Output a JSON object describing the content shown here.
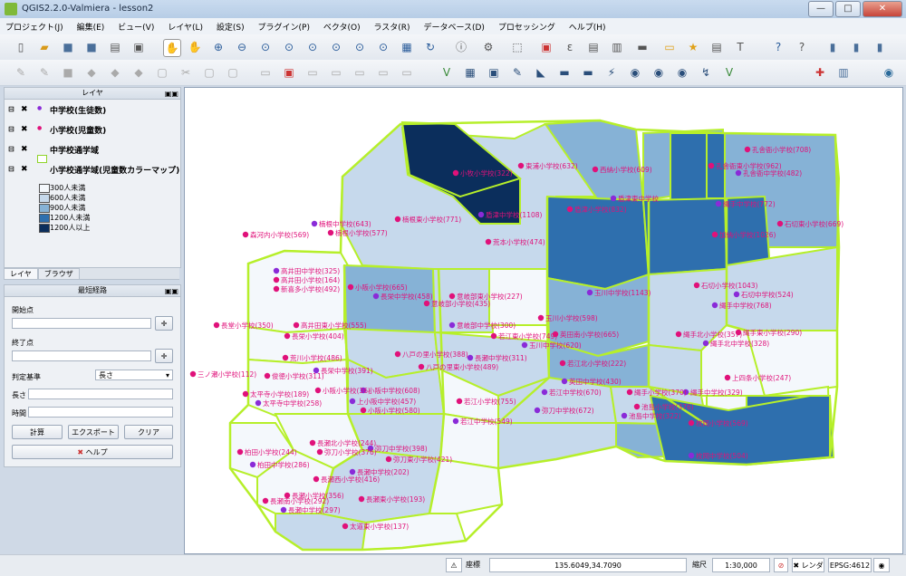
{
  "window": {
    "title": "QGIS2.2.0-Valmiera - lesson2",
    "minimize": "—",
    "maximize": "□",
    "close": "✕"
  },
  "menu": [
    "プロジェクト(J)",
    "編集(E)",
    "ビュー(V)",
    "レイヤ(L)",
    "設定(S)",
    "プラグイン(P)",
    "ベクタ(O)",
    "ラスタ(R)",
    "データベース(D)",
    "プロセッシング",
    "ヘルプ(H)"
  ],
  "layers_panel": {
    "title": "レイヤ",
    "layers": [
      {
        "name": "中学校(生徒数)"
      },
      {
        "name": "小学校(児童数)"
      },
      {
        "name": "中学校通学域"
      },
      {
        "name": "小学校通学域(児童数カラーマップ)"
      }
    ],
    "legend": [
      {
        "label": "300人未満",
        "color": "#f4f8fc"
      },
      {
        "label": "600人未満",
        "color": "#c6d9ec"
      },
      {
        "label": "900人未満",
        "color": "#86b2d6"
      },
      {
        "label": "1200人未満",
        "color": "#2e6fae"
      },
      {
        "label": "1200人以上",
        "color": "#0b2e5c"
      }
    ]
  },
  "tabs": [
    "レイヤ",
    "ブラウザ"
  ],
  "route_panel": {
    "title": "最短経路",
    "start_label": "開始点",
    "end_label": "終了点",
    "criterion_label": "判定基準",
    "criterion_value": "長さ",
    "length_label": "長さ",
    "time_label": "時間",
    "calc": "計算",
    "export": "エクスポート",
    "clear": "クリア",
    "help": "ヘルプ"
  },
  "map_labels": [
    {
      "t": "東浦小学校(632)"
    },
    {
      "t": "西納小学校(609)"
    },
    {
      "t": "小牧小学校(322)"
    },
    {
      "t": "孔舎衙小学校(708)"
    },
    {
      "t": "孔舎衙東小学校(962)"
    },
    {
      "t": "孔舎衙中学校(482)"
    },
    {
      "t": "森河内小学校(569)"
    },
    {
      "t": "楠根中学校(643)"
    },
    {
      "t": "楠根小学校(577)"
    },
    {
      "t": "楠根東小学校(771)"
    },
    {
      "t": "盾津中学校(1108)"
    },
    {
      "t": "盾津東中学校"
    },
    {
      "t": "盾津小学校(832)"
    },
    {
      "t": "縄手中学校(772)"
    },
    {
      "t": "石切東小学校(669)"
    },
    {
      "t": "加納小学校(1026)"
    },
    {
      "t": "荒本小学校(474)"
    },
    {
      "t": "長堂小学校(350)"
    },
    {
      "t": "高井田中学校(325)"
    },
    {
      "t": "高井田小学校(164)"
    },
    {
      "t": "新喜多小学校(492)"
    },
    {
      "t": "小阪小学校(665)"
    },
    {
      "t": "長栄中学校(458)"
    },
    {
      "t": "意岐部東小学校(227)"
    },
    {
      "t": "意岐部小学校(435)"
    },
    {
      "t": "玉川中学校(1143)"
    },
    {
      "t": "石切小学校(1043)"
    },
    {
      "t": "石切中学校(524)"
    },
    {
      "t": "縄手中学校(768)"
    },
    {
      "t": "高井田東小学校(555)"
    },
    {
      "t": "長栄小学校(404)"
    },
    {
      "t": "意岐部中学校(300)"
    },
    {
      "t": "玉川小学校(598)"
    },
    {
      "t": "若江東小学校(749)"
    },
    {
      "t": "英田南小学校(665)"
    },
    {
      "t": "縄手北小学校(357)"
    },
    {
      "t": "縄手東小学校(290)"
    },
    {
      "t": "縄手北中学校(328)"
    },
    {
      "t": "八戸の里小学校(388)"
    },
    {
      "t": "玉川中学校(620)"
    },
    {
      "t": "荒川小学校(486)"
    },
    {
      "t": "長瀬中学校(311)"
    },
    {
      "t": "三ノ瀬小学校(112)"
    },
    {
      "t": "俊徳小学校(311)"
    },
    {
      "t": "長栄中学校(391)"
    },
    {
      "t": "八戸の里東小学校(489)"
    },
    {
      "t": "若江北小学校(222)"
    },
    {
      "t": "上四条小学校(247)"
    },
    {
      "t": "太平寺小学校(189)"
    },
    {
      "t": "小阪小学校(36)"
    },
    {
      "t": "小阪中学校(608)"
    },
    {
      "t": "英田中学校(430)"
    },
    {
      "t": "縄手小学校(370)"
    },
    {
      "t": "縄手中学校(329)"
    },
    {
      "t": "太平寺中学校(258)"
    },
    {
      "t": "上小阪中学校(457)"
    },
    {
      "t": "小阪小学校(580)"
    },
    {
      "t": "若江中学校(670)"
    },
    {
      "t": "若江小学校(755)"
    },
    {
      "t": "弥刀中学校(672)"
    },
    {
      "t": "池島小学校(376)"
    },
    {
      "t": "池島中学校(322)"
    },
    {
      "t": "枚岡小学校(569)"
    },
    {
      "t": "若江中学校(549)"
    },
    {
      "t": "長瀬北小学校(244)"
    },
    {
      "t": "弥刀小学校(376)"
    },
    {
      "t": "弥刀中学校(398)"
    },
    {
      "t": "弥刀東小学校(421)"
    },
    {
      "t": "柏田小学校(244)"
    },
    {
      "t": "柏田中学校(286)"
    },
    {
      "t": "長瀬西小学校(416)"
    },
    {
      "t": "長瀬中学校(202)"
    },
    {
      "t": "長瀬小学校(356)"
    },
    {
      "t": "長瀬南小学校(292)"
    },
    {
      "t": "長瀬東小学校(193)"
    },
    {
      "t": "長瀬中学校(297)"
    },
    {
      "t": "太道東小学校(137)"
    },
    {
      "t": "枚岡中学校(504)"
    }
  ],
  "status": {
    "coord_label": "座標",
    "coord_value": "135.6049,34.7090",
    "scale_label": "縮尺",
    "scale_value": "1:30,000",
    "render_label": "レンダ",
    "epsg": "EPSG:4612"
  }
}
